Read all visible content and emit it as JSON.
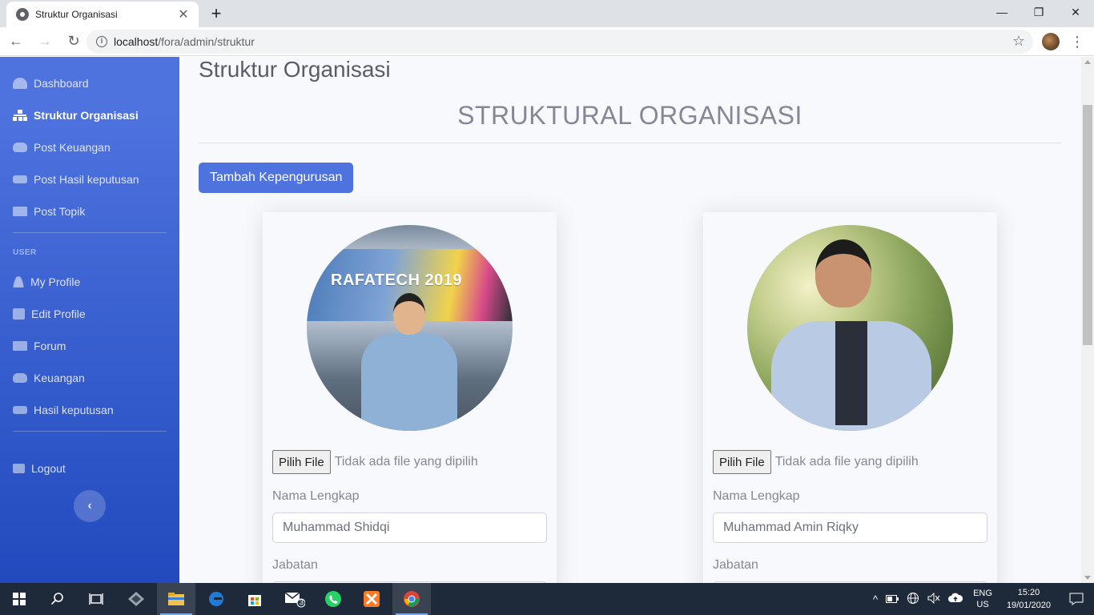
{
  "browser": {
    "tab_title": "Struktur Organisasi",
    "tab_close": "✕",
    "new_tab": "+",
    "url_host": "localhost",
    "url_path": "/fora/admin/struktur",
    "controls": {
      "minimize": "—",
      "maximize": "❐",
      "close": "✕"
    },
    "nav": {
      "back": "←",
      "forward": "→",
      "reload": "↻"
    },
    "star": "☆",
    "menu": "⋮"
  },
  "sidebar": {
    "items": [
      {
        "label": "Dashboard",
        "icon": "tachometer-icon"
      },
      {
        "label": "Struktur Organisasi",
        "icon": "sitemap-icon",
        "active": true
      },
      {
        "label": "Post Keuangan",
        "icon": "coins-icon"
      },
      {
        "label": "Post Hasil keputusan",
        "icon": "handshake-icon"
      },
      {
        "label": "Post Topik",
        "icon": "book-icon"
      }
    ],
    "heading_user": "USER",
    "user_items": [
      {
        "label": "My Profile",
        "icon": "user-icon"
      },
      {
        "label": "Edit Profile",
        "icon": "edit-icon"
      },
      {
        "label": "Forum",
        "icon": "book-icon"
      },
      {
        "label": "Keuangan",
        "icon": "coins-icon"
      },
      {
        "label": "Hasil keputusan",
        "icon": "handshake-icon"
      }
    ],
    "logout": {
      "label": "Logout",
      "icon": "sign-out-icon"
    },
    "toggle": "‹"
  },
  "main": {
    "page_title": "Struktur Organisasi",
    "section_title": "STRUKTURAL ORGANISASI",
    "add_button": "Tambah Kepengurusan",
    "cards": [
      {
        "photo_banner_text": "RAFATECH 2019",
        "file_button": "Pilih File",
        "file_status": "Tidak ada file yang dipilih",
        "name_label": "Nama Lengkap",
        "name_value": "Muhammad Shidqi",
        "position_label": "Jabatan"
      },
      {
        "file_button": "Pilih File",
        "file_status": "Tidak ada file yang dipilih",
        "name_label": "Nama Lengkap",
        "name_value": "Muhammad Amin Riqky",
        "position_label": "Jabatan"
      }
    ]
  },
  "taskbar": {
    "mail_badge": "3",
    "lang_1": "ENG",
    "lang_2": "US",
    "time": "15:20",
    "date": "19/01/2020"
  },
  "colors": {
    "primary": "#4e73df",
    "sidebar_gradient_end": "#224abe",
    "content_bg": "#f8f9fc",
    "muted_text": "#858796"
  }
}
